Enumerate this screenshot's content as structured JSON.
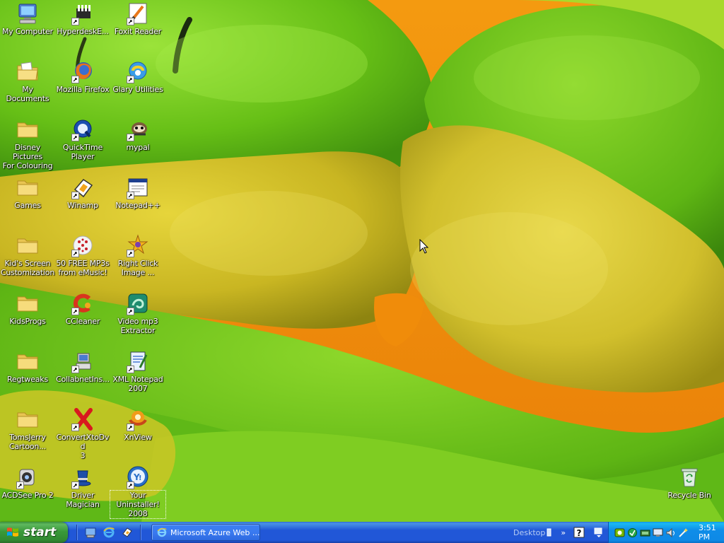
{
  "desktop": {
    "icons": [
      {
        "id": "my-computer",
        "label": "My Computer",
        "icon": "computer-icon",
        "shortcut": false
      },
      {
        "id": "hyperdesk",
        "label": "HyperdeskE...",
        "icon": "hyperdesk-icon",
        "shortcut": true
      },
      {
        "id": "foxit",
        "label": "Foxit Reader",
        "icon": "foxit-reader-icon",
        "shortcut": true
      },
      {
        "id": "my-documents",
        "label": "My Documents",
        "icon": "documents-folder-icon",
        "shortcut": false
      },
      {
        "id": "firefox",
        "label": "Mozilla Firefox",
        "icon": "firefox-icon",
        "shortcut": true
      },
      {
        "id": "glary",
        "label": "Glary Utilities",
        "icon": "glary-utilities-icon",
        "shortcut": true
      },
      {
        "id": "disney",
        "label": "Disney Pictures\nFor Colouring",
        "icon": "folder-icon",
        "shortcut": false
      },
      {
        "id": "quicktime",
        "label": "QuickTime\nPlayer",
        "icon": "quicktime-icon",
        "shortcut": true
      },
      {
        "id": "mypal",
        "label": "mypal",
        "icon": "mypal-icon",
        "shortcut": true
      },
      {
        "id": "games",
        "label": "Games",
        "icon": "folder-icon",
        "shortcut": false
      },
      {
        "id": "winamp",
        "label": "Winamp",
        "icon": "winamp-icon",
        "shortcut": true
      },
      {
        "id": "notepadpp",
        "label": "Notepad++",
        "icon": "notepad-plus-plus-icon",
        "shortcut": true
      },
      {
        "id": "kids-screen",
        "label": "Kid's Screen\nCustomization",
        "icon": "folder-icon",
        "shortcut": false
      },
      {
        "id": "free-mp3",
        "label": "50 FREE MP3s\nfrom eMusic!",
        "icon": "emusic-icon",
        "shortcut": true
      },
      {
        "id": "right-click-image",
        "label": "Right Click\nImage ...",
        "icon": "right-click-image-icon",
        "shortcut": true
      },
      {
        "id": "kidsprogs",
        "label": "KidsProgs",
        "icon": "folder-icon",
        "shortcut": false
      },
      {
        "id": "ccleaner",
        "label": "CCleaner",
        "icon": "ccleaner-icon",
        "shortcut": true
      },
      {
        "id": "video-mp3",
        "label": "Video mp3\nExtractor",
        "icon": "video-mp3-extractor-icon",
        "shortcut": true
      },
      {
        "id": "regtweaks",
        "label": "Regtweaks",
        "icon": "folder-icon",
        "shortcut": false
      },
      {
        "id": "collabnet",
        "label": "CollabnetIns...",
        "icon": "collabnet-icon",
        "shortcut": true
      },
      {
        "id": "xml-notepad",
        "label": "XML Notepad\n2007",
        "icon": "xml-notepad-icon",
        "shortcut": true
      },
      {
        "id": "tomsjerry",
        "label": "TomsJerry\nCartoon...",
        "icon": "folder-icon",
        "shortcut": false
      },
      {
        "id": "convertxtodvd",
        "label": "ConvertXtoDvd\n3",
        "icon": "convertxtodvd-icon",
        "shortcut": true
      },
      {
        "id": "xnview",
        "label": "XnView",
        "icon": "xnview-icon",
        "shortcut": true
      },
      {
        "id": "acdsee",
        "label": "ACDSee Pro 2",
        "icon": "acdsee-icon",
        "shortcut": true
      },
      {
        "id": "driver-magician",
        "label": "Driver Magician",
        "icon": "driver-magician-icon",
        "shortcut": true
      },
      {
        "id": "your-uninstaller",
        "label": "Your\nUninstaller!\n2008",
        "icon": "your-uninstaller-icon",
        "shortcut": true
      },
      {
        "id": "recycle-bin",
        "label": "Recycle Bin",
        "icon": "recycle-bin-icon",
        "shortcut": false
      }
    ]
  },
  "taskbar": {
    "start_label": "start",
    "quick_launch": [
      "show-desktop-icon",
      "internet-explorer-icon",
      "winamp-agent-icon"
    ],
    "task_button_label": "Microsoft Azure Web ...",
    "desktop_toolbar_label": "Desktop",
    "clock": "3:51 PM"
  },
  "colors": {
    "taskbar_blue": "#2157d7",
    "start_green": "#3a9a3a",
    "tray_blue": "#0f8de8",
    "wallpaper_green": "#6fc21a",
    "wallpaper_yellow": "#d8c42a",
    "wallpaper_orange": "#f29a12"
  }
}
